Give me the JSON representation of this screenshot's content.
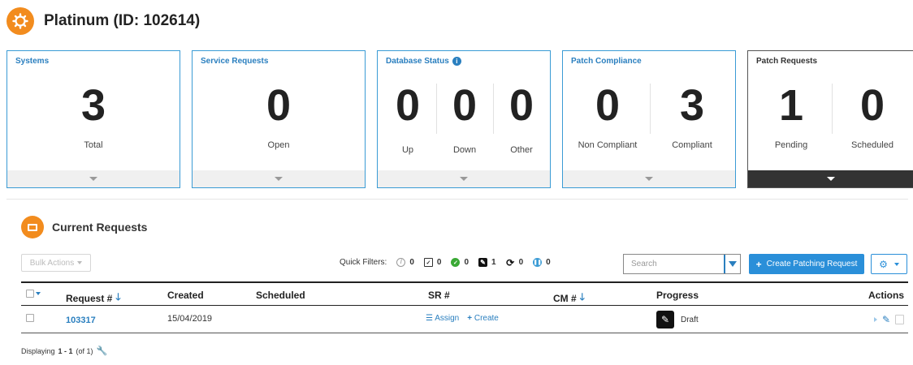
{
  "header": {
    "title": "Platinum (ID: 102614)"
  },
  "cards": {
    "systems": {
      "title": "Systems",
      "value": "3",
      "label": "Total"
    },
    "service_requests": {
      "title": "Service Requests",
      "value": "0",
      "label": "Open"
    },
    "database_status": {
      "title": "Database Status",
      "metrics": [
        {
          "value": "0",
          "label": "Up"
        },
        {
          "value": "0",
          "label": "Down"
        },
        {
          "value": "0",
          "label": "Other"
        }
      ]
    },
    "patch_compliance": {
      "title": "Patch Compliance",
      "metrics": [
        {
          "value": "0",
          "label": "Non Compliant"
        },
        {
          "value": "3",
          "label": "Compliant"
        }
      ]
    },
    "patch_requests": {
      "title": "Patch Requests",
      "metrics": [
        {
          "value": "1",
          "label": "Pending"
        },
        {
          "value": "0",
          "label": "Scheduled"
        }
      ]
    }
  },
  "panel": {
    "title": "Current Requests"
  },
  "toolbar": {
    "bulk_actions": "Bulk Actions",
    "quick_filters_label": "Quick Filters:",
    "quick_filters": [
      {
        "icon": "ban-icon",
        "count": "0"
      },
      {
        "icon": "calendar-icon",
        "count": "0"
      },
      {
        "icon": "check-circle-icon",
        "count": "0"
      },
      {
        "icon": "edit-square-icon",
        "count": "1"
      },
      {
        "icon": "sync-icon",
        "count": "0"
      },
      {
        "icon": "pause-circle-icon",
        "count": "0"
      }
    ],
    "search_placeholder": "Search",
    "create_button": "Create Patching Request"
  },
  "table": {
    "columns": [
      "Request #",
      "Created",
      "Scheduled",
      "SR #",
      "CM #",
      "Progress",
      "Actions"
    ],
    "rows": [
      {
        "request": "103317",
        "created": "15/04/2019",
        "scheduled": "",
        "sr_assign": "Assign",
        "sr_create": "Create",
        "cm": "",
        "progress": "Draft"
      }
    ]
  },
  "footer": {
    "prefix": "Displaying",
    "range": "1 - 1",
    "suffix": "(of 1)"
  },
  "colors": {
    "accent": "#2a8fd9",
    "brand_orange": "#f28c1e",
    "dark_card": "#333333"
  }
}
